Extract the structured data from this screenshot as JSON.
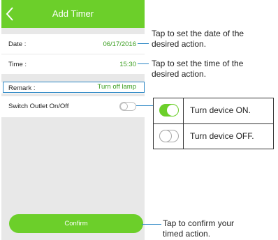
{
  "app": {
    "title": "Add Timer",
    "accent_color": "#6ccf2a",
    "back_icon": "chevron-left-icon"
  },
  "form": {
    "date_label": "Date :",
    "date_value": "06/17/2016",
    "time_label": "Time :",
    "time_value": "15:30",
    "remark_label": "Remark :",
    "remark_value": "Turn off lamp",
    "switch_label": "Switch Outlet On/Off",
    "switch_state": "off",
    "confirm_label": "Confirm"
  },
  "annotations": {
    "date_line1": "Tap to set the date of the",
    "date_line2": "desired action.",
    "time_line1": "Tap to set the time of the",
    "time_line2": "desired action.",
    "confirm_line1": "Tap to confirm your",
    "confirm_line2": "timed action."
  },
  "legend": {
    "on_text": "Turn device ON.",
    "off_text": "Turn device OFF."
  }
}
